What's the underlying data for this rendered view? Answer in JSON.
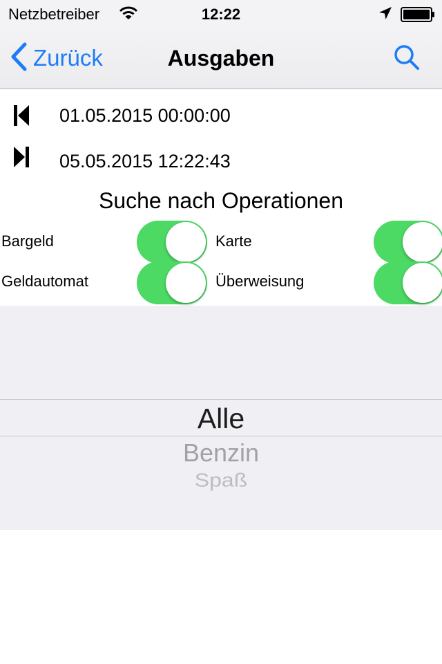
{
  "status_bar": {
    "carrier": "Netzbetreiber",
    "time": "12:22",
    "wifi_icon": "wifi-icon",
    "location_icon": "location-arrow-icon",
    "battery_icon": "battery-icon"
  },
  "nav": {
    "back_label": "Zurück",
    "title": "Ausgaben",
    "search_icon": "search-icon"
  },
  "dates": {
    "start": "01.05.2015 00:00:00",
    "end": "05.05.2015 12:22:43"
  },
  "filter": {
    "title": "Suche nach Operationen",
    "toggles": [
      {
        "label": "Bargeld",
        "on": true
      },
      {
        "label": "Karte",
        "on": true
      },
      {
        "label": "Geldautomat",
        "on": true
      },
      {
        "label": "Überweisung",
        "on": true
      }
    ]
  },
  "picker": {
    "selected": "Alle",
    "options": [
      "Alle",
      "Benzin",
      "Spaß"
    ]
  },
  "colors": {
    "accent": "#1e7cf6",
    "switch_on": "#4cd964"
  }
}
